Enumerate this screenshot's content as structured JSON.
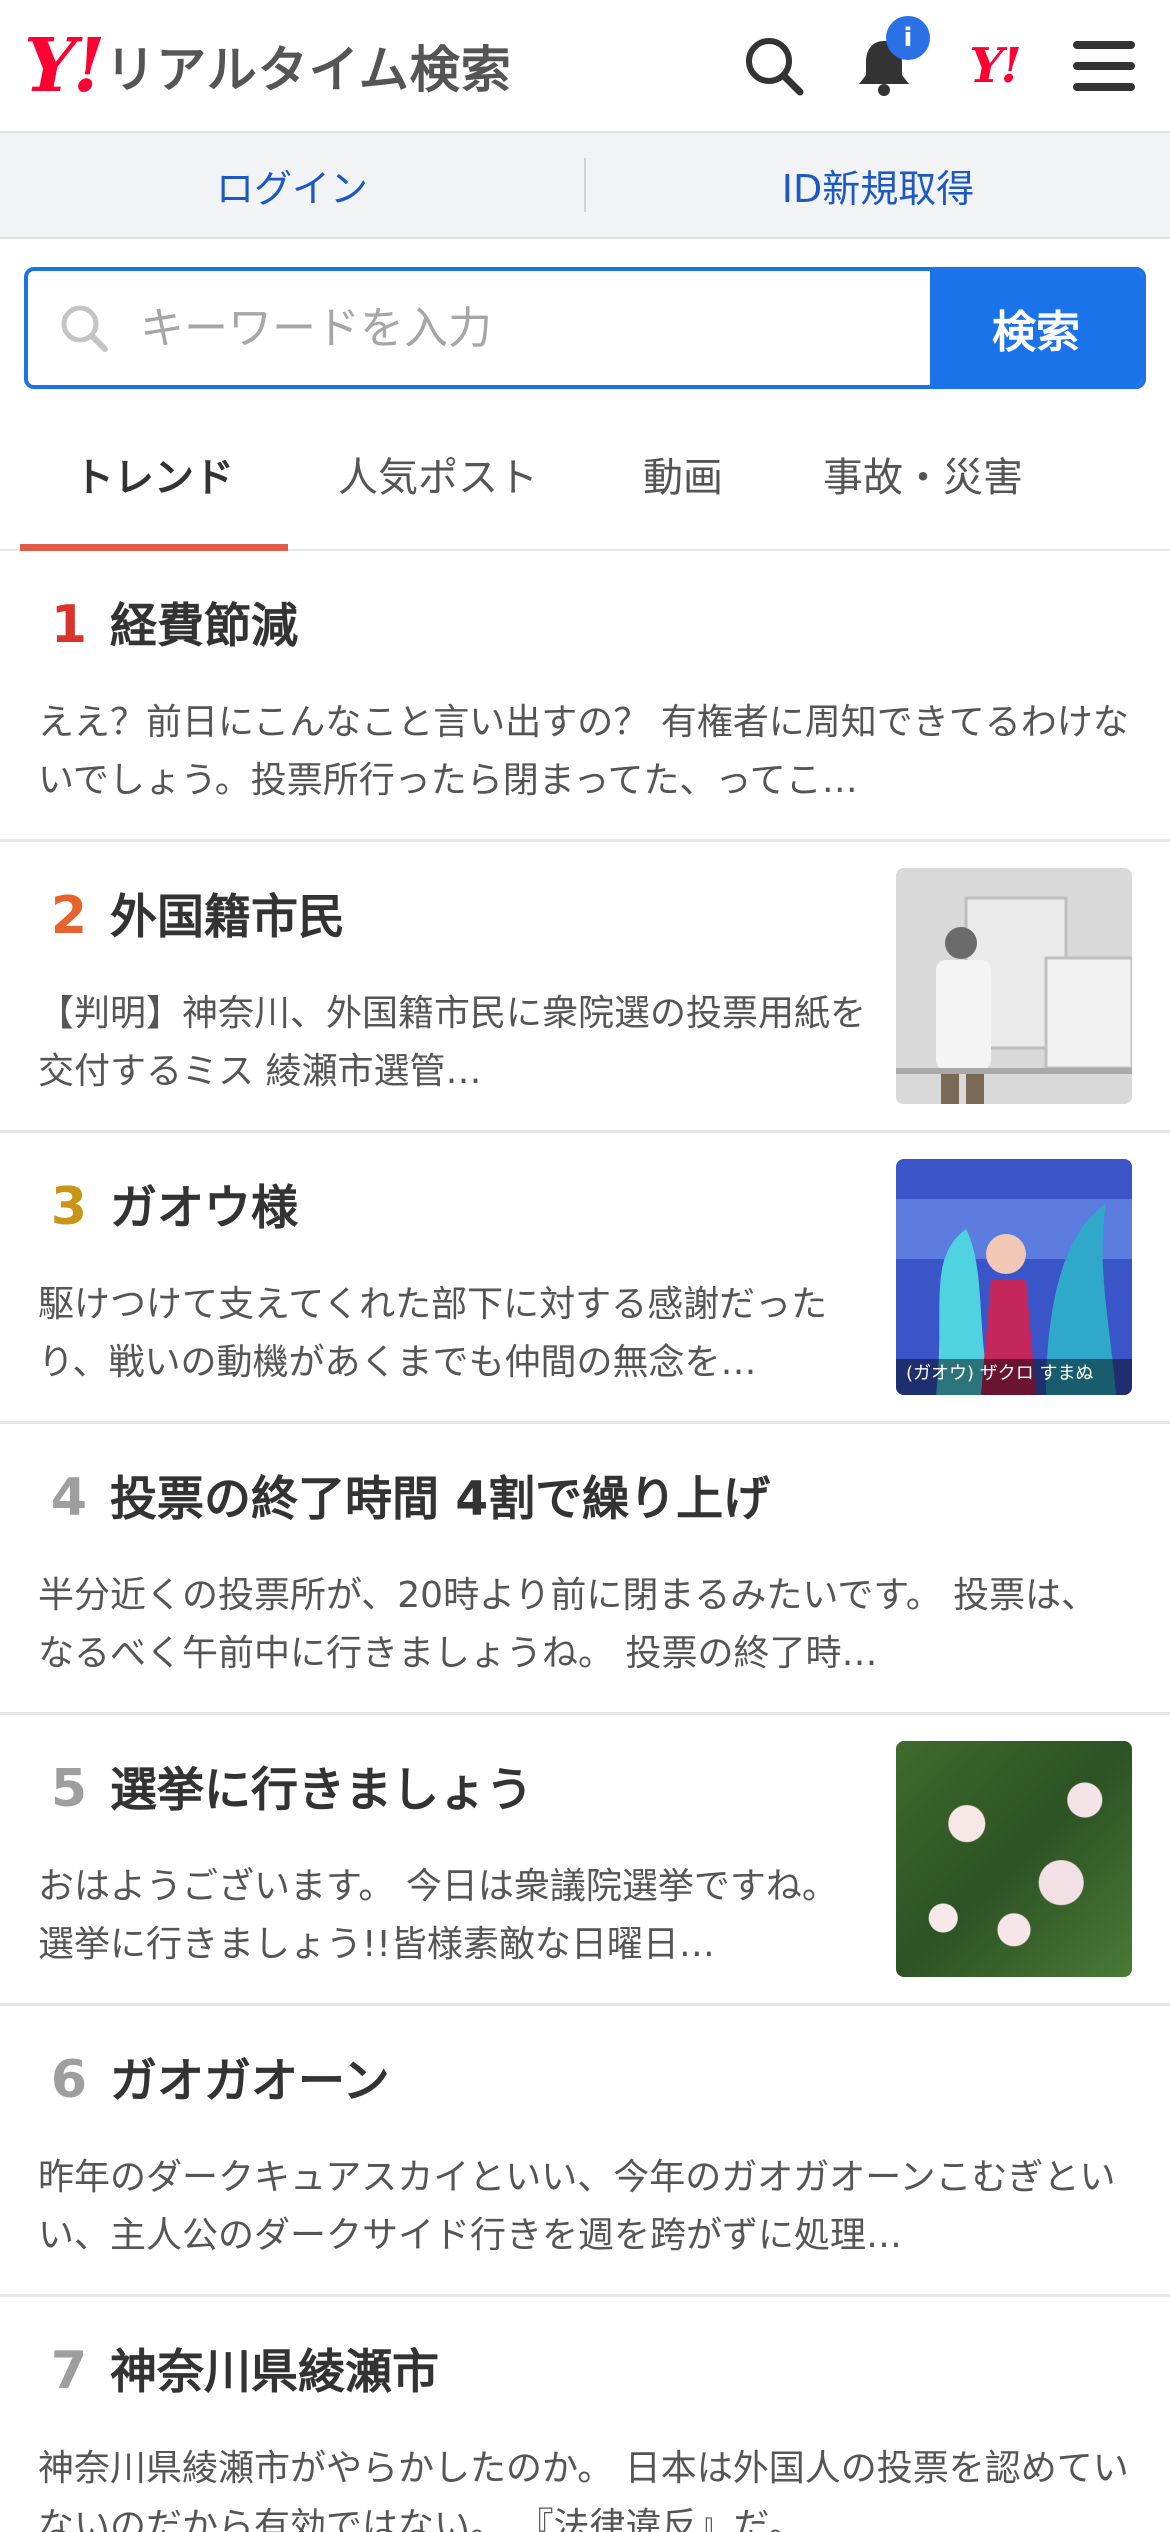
{
  "header": {
    "logo_mark": "Y!",
    "logo_text": "リアルタイム検索",
    "notification_count": "i",
    "yahoo_mark": "Y!"
  },
  "login_bar": {
    "login_label": "ログイン",
    "signup_label": "ID新規取得"
  },
  "search": {
    "placeholder": "キーワードを入力",
    "button_label": "検索"
  },
  "tabs": [
    {
      "label": "トレンド",
      "active": true
    },
    {
      "label": "人気ポスト",
      "active": false
    },
    {
      "label": "動画",
      "active": false
    },
    {
      "label": "事故・災害",
      "active": false
    }
  ],
  "colors": {
    "accent_blue": "#1a73e8",
    "brand_red": "#ff0033",
    "rank_1": "#d9342b",
    "rank_2": "#e8622e",
    "rank_3": "#c99518",
    "rank_other": "#9e9e9e",
    "tab_underline": "#e05a4a"
  },
  "trends": [
    {
      "rank": "1",
      "title": "経費節減",
      "desc": "ええ？前日にこんなこと言い出すの？ 有権者に周知できてるわけないでしょう。投票所行ったら閉まってた、ってこ…",
      "thumb": null
    },
    {
      "rank": "2",
      "title": "外国籍市民",
      "desc": "【判明】神奈川、外国籍市民に衆院選の投票用紙を交付するミス 綾瀬市選管…",
      "thumb": "election-booth-photo"
    },
    {
      "rank": "3",
      "title": "ガオウ様",
      "desc": "駆けつけて支えてくれた部下に対する感謝だったり、戦いの動機があくまでも仲間の無念を…",
      "thumb": "anime-screenshot",
      "thumb_caption": "(ガオウ) ザクロ すまぬ"
    },
    {
      "rank": "4",
      "title": "投票の終了時間 4割で繰り上げ",
      "desc": "半分近くの投票所が、20時より前に閉まるみたいです。 投票は、なるべく午前中に行きましょうね。 投票の終了時…",
      "thumb": null
    },
    {
      "rank": "5",
      "title": "選挙に行きましょう",
      "desc": "おはようございます。 今日は衆議院選挙ですね。選挙に行きましょう!!皆様素敵な日曜日…",
      "thumb": "white-roses-photo"
    },
    {
      "rank": "6",
      "title": "ガオガオーン",
      "desc": "昨年のダークキュアスカイといい、今年のガオガオーンこむぎといい、主人公のダークサイド行きを週を跨がずに処理…",
      "thumb": null
    },
    {
      "rank": "7",
      "title": "神奈川県綾瀬市",
      "desc": "神奈川県綾瀬市がやらかしたのか。 日本は外国人の投票を認めていないのだから有効ではない。 『法律違反』だ。 …",
      "thumb": null
    }
  ]
}
